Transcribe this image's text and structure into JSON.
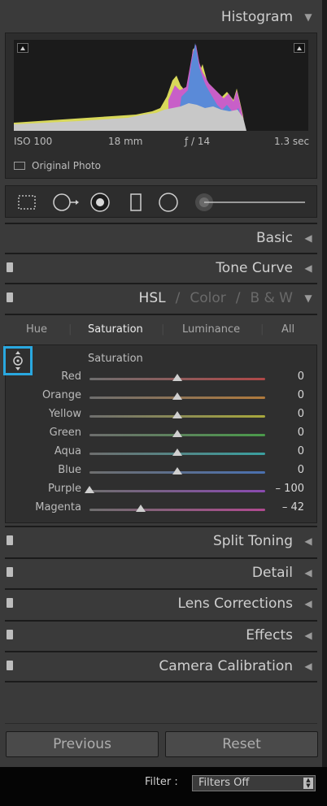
{
  "histogram": {
    "title": "Histogram",
    "iso": "ISO 100",
    "focal_length": "18 mm",
    "aperture": "ƒ / 14",
    "shutter": "1.3 sec",
    "original_photo_label": "Original Photo"
  },
  "tools": [
    "crop-overlay",
    "spot-removal",
    "red-eye",
    "graduated-filter",
    "radial-filter",
    "adjustment-brush"
  ],
  "panels": {
    "basic": "Basic",
    "tone_curve": "Tone Curve",
    "hsl": {
      "hsl": "HSL",
      "sep1": "/",
      "color": "Color",
      "sep2": "/",
      "bw": "B & W"
    },
    "split_toning": "Split Toning",
    "detail": "Detail",
    "lens_corrections": "Lens Corrections",
    "effects": "Effects",
    "camera_calibration": "Camera Calibration"
  },
  "hsl_tabs": {
    "hue": "Hue",
    "saturation": "Saturation",
    "luminance": "Luminance",
    "all": "All",
    "active": "Saturation"
  },
  "section_label": "Saturation",
  "sliders": [
    {
      "name": "Red",
      "value": "0",
      "amount": 0,
      "color": "#b04848"
    },
    {
      "name": "Orange",
      "value": "0",
      "amount": 0,
      "color": "#b07a3c"
    },
    {
      "name": "Yellow",
      "value": "0",
      "amount": 0,
      "color": "#a8a83c"
    },
    {
      "name": "Green",
      "value": "0",
      "amount": 0,
      "color": "#4a9a4a"
    },
    {
      "name": "Aqua",
      "value": "0",
      "amount": 0,
      "color": "#3aa0a0"
    },
    {
      "name": "Blue",
      "value": "0",
      "amount": 0,
      "color": "#4a70b0"
    },
    {
      "name": "Purple",
      "value": "– 100",
      "amount": -100,
      "color": "#8a4ab0"
    },
    {
      "name": "Magenta",
      "value": "– 42",
      "amount": -42,
      "color": "#b04a90"
    }
  ],
  "buttons": {
    "previous": "Previous",
    "reset": "Reset"
  },
  "filter": {
    "label": "Filter :",
    "value": "Filters Off"
  }
}
